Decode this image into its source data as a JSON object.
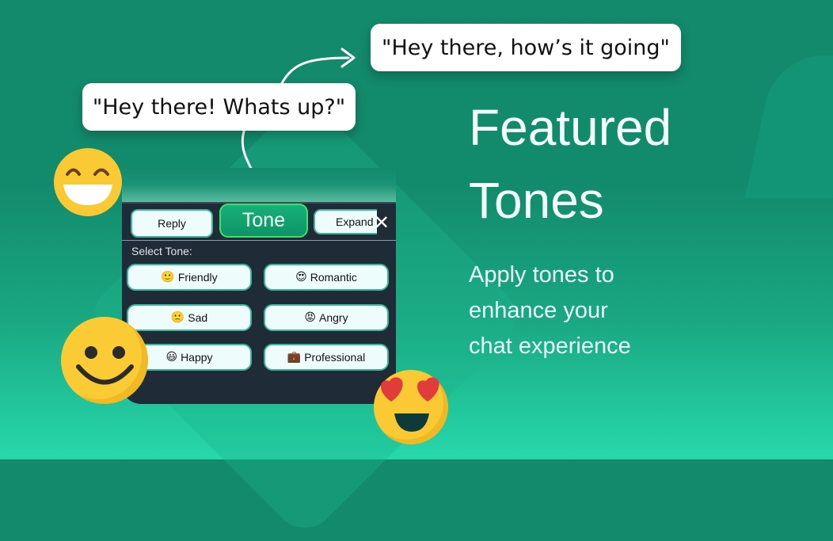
{
  "bubbles": {
    "original": "\"Hey there! Whats up?\"",
    "rewritten": "\"Hey there, how’s it going\""
  },
  "keyboard": {
    "tabs": [
      {
        "label": "Reply"
      },
      {
        "label": "Tone",
        "active": true
      },
      {
        "label": "Expand"
      }
    ],
    "close_icon": "✕",
    "select_label": "Select Tone:",
    "tones": [
      {
        "emoji": "🙂",
        "label": "Friendly",
        "icon": "slightly-smiling-face-icon"
      },
      {
        "emoji": "😍",
        "label": "Romantic",
        "icon": "heart-eyes-face-icon"
      },
      {
        "emoji": "🙁",
        "label": "Sad",
        "icon": "frowning-face-icon"
      },
      {
        "emoji": "😡",
        "label": "Angry",
        "icon": "angry-face-icon"
      },
      {
        "emoji": "😃",
        "label": "Happy",
        "icon": "grinning-face-icon"
      },
      {
        "emoji": "💼",
        "label": "Professional",
        "icon": "briefcase-icon"
      }
    ]
  },
  "hero": {
    "title_line1": "Featured",
    "title_line2": "Tones",
    "subtitle_line1": "Apply tones to",
    "subtitle_line2": "enhance your",
    "subtitle_line3": "chat experience"
  },
  "colors": {
    "accent_green": "#18b07a",
    "accent_border": "#3ee06c",
    "keyboard_bg": "#1f2b36",
    "button_bg": "#eefcfb",
    "emoji_yellow": "#fbc933"
  }
}
